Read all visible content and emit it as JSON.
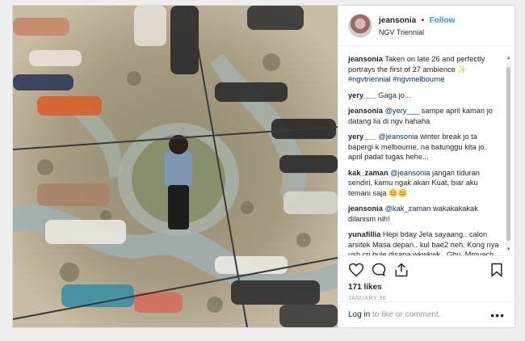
{
  "post": {
    "username": "jeansonia",
    "dot": "•",
    "follow_label": "Follow",
    "location": "NGV Triennial",
    "likes": "171 likes",
    "date": "JANUARY 30",
    "login_link": "Log in",
    "login_rest": " to like or comment.",
    "more": "•••"
  },
  "comments": [
    {
      "user": "jeansonia",
      "parts": [
        {
          "t": "Taken on late 26 and perfectly portrays the first of 27 ambience ✨ "
        },
        {
          "t": "#ngvtriennial #ngvmelbourne",
          "tag": true
        }
      ]
    },
    {
      "user": "yery___",
      "parts": [
        {
          "t": "Gaga jo..."
        }
      ]
    },
    {
      "user": "jeansonia",
      "parts": [
        {
          "t": "@yery___",
          "tag": true
        },
        {
          "t": " sampe april kamari jo datang lia di ngv hahaha"
        }
      ]
    },
    {
      "user": "yery___",
      "parts": [
        {
          "t": "@jeansonia",
          "tag": true
        },
        {
          "t": " winter break jo ta bapergi k melbourne, na batunggu kita jo. april padat tugas hehe..."
        }
      ]
    },
    {
      "user": "kak_zaman",
      "parts": [
        {
          "t": "@jeansonia",
          "tag": true
        },
        {
          "t": " jangan tiduran sendiri, kamu ngak akan Kuat, biar aku temani saja 😊😊"
        }
      ]
    },
    {
      "user": "jeansonia",
      "parts": [
        {
          "t": "@kak_zaman",
          "tag": true
        },
        {
          "t": " wakakakakak dilanism nih!"
        }
      ]
    },
    {
      "user": "yunafillia",
      "parts": [
        {
          "t": "Hepi bday Jela sayaang.. calon arsitek Masa depan.. kul bae2 neh. Kong nya ush cri bule disana.wkwkwk.. Gbu..Mmuach 😘😘"
        }
      ]
    }
  ],
  "icons": {
    "like": "heart-icon",
    "comment": "comment-icon",
    "share": "share-icon",
    "save": "bookmark-icon"
  },
  "colors": {
    "link": "#3897f0",
    "tag": "#003569",
    "border": "#dbdbdb"
  }
}
